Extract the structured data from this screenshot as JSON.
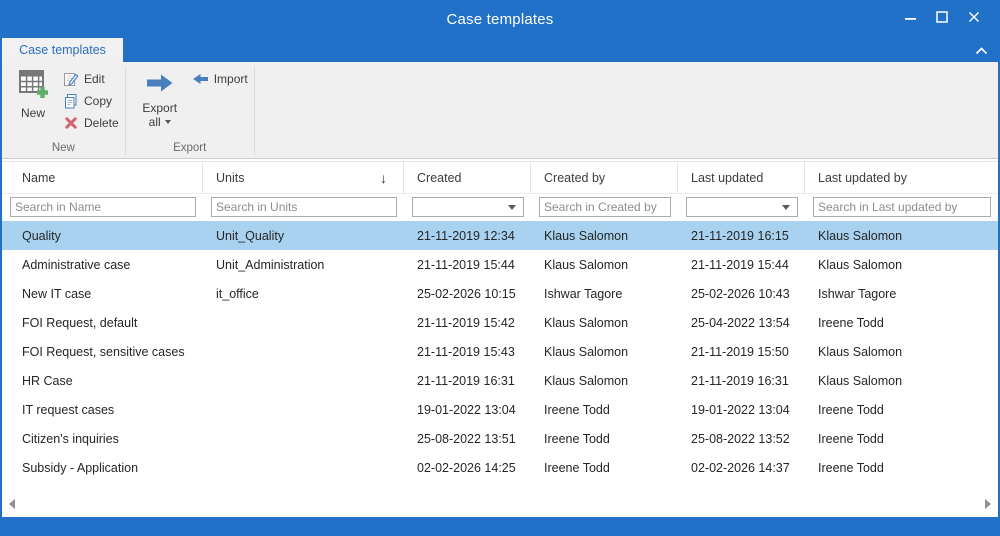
{
  "window": {
    "title": "Case templates"
  },
  "tab": {
    "label": "Case templates"
  },
  "ribbon": {
    "new_button": "New",
    "edit_button": "Edit",
    "copy_button": "Copy",
    "delete_button": "Delete",
    "export_button_line1": "Export",
    "export_button_line2": "all",
    "import_button": "Import",
    "group_new_label": "New",
    "group_export_label": "Export"
  },
  "icons": {
    "sort_descending": "↓"
  },
  "table": {
    "columns": [
      {
        "label": "Name",
        "filter": {
          "type": "text",
          "placeholder": "Search in Name"
        }
      },
      {
        "label": "Units",
        "sort": "desc",
        "filter": {
          "type": "text",
          "placeholder": "Search in Units"
        }
      },
      {
        "label": "Created",
        "filter": {
          "type": "dropdown",
          "value": ""
        }
      },
      {
        "label": "Created by",
        "filter": {
          "type": "text",
          "placeholder": "Search in Created by"
        }
      },
      {
        "label": "Last updated",
        "filter": {
          "type": "dropdown",
          "value": ""
        }
      },
      {
        "label": "Last updated by",
        "filter": {
          "type": "text",
          "placeholder": "Search in Last updated by"
        }
      }
    ],
    "selected_row_index": 0,
    "rows": [
      [
        "Quality",
        "Unit_Quality",
        "21-11-2019 12:34",
        "Klaus Salomon",
        "21-11-2019 16:15",
        "Klaus Salomon"
      ],
      [
        "Administrative case",
        "Unit_Administration",
        "21-11-2019 15:44",
        "Klaus Salomon",
        "21-11-2019 15:44",
        "Klaus Salomon"
      ],
      [
        "New IT case",
        "it_office",
        "25-02-2026 10:15",
        "Ishwar Tagore",
        "25-02-2026 10:43",
        "Ishwar Tagore"
      ],
      [
        "FOI Request, default",
        "",
        "21-11-2019 15:42",
        "Klaus Salomon",
        "25-04-2022 13:54",
        "Ireene Todd"
      ],
      [
        "FOI Request, sensitive cases",
        "",
        "21-11-2019 15:43",
        "Klaus Salomon",
        "21-11-2019 15:50",
        "Klaus Salomon"
      ],
      [
        "HR Case",
        "",
        "21-11-2019 16:31",
        "Klaus Salomon",
        "21-11-2019 16:31",
        "Klaus Salomon"
      ],
      [
        "IT request cases",
        "",
        "19-01-2022 13:04",
        "Ireene Todd",
        "19-01-2022 13:04",
        "Ireene Todd"
      ],
      [
        "Citizen's inquiries",
        "",
        "25-08-2022 13:51",
        "Ireene Todd",
        "25-08-2022 13:52",
        "Ireene Todd"
      ],
      [
        "Subsidy - Application",
        "",
        "02-02-2026 14:25",
        "Ireene Todd",
        "02-02-2026 14:37",
        "Ireene Todd"
      ]
    ]
  },
  "colors": {
    "accent_blue": "#2171c9",
    "selected_row": "#a9d2f1",
    "ribbon_icon_blue": "#4a7fbe",
    "delete_red": "#d66273",
    "new_plus_green": "#5fae69"
  }
}
